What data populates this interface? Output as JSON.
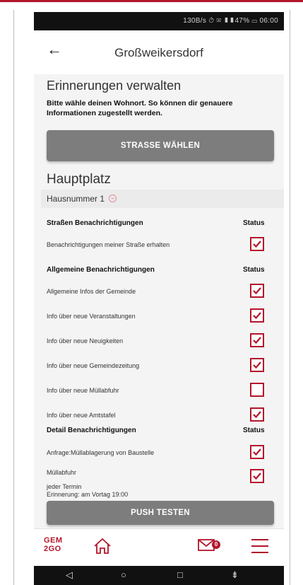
{
  "statusbar": {
    "text": "130B/s ⏱ ✉ ▮▮47% ▭ 06:00"
  },
  "header": {
    "back_icon": "arrow-left-icon",
    "title": "Großweikersdorf"
  },
  "main": {
    "heading": "Erinnerungen verwalten",
    "intro": "Bitte wähle deinen Wohnort. So können dir genauere Informationen zugestellt werden.",
    "select_street_button": "STRASSE WÄHLEN",
    "street_name": "Hauptplatz",
    "house_number_label": "Hausnummer 1",
    "remove_icon": "minus-circle-icon",
    "status_header": "Status",
    "sections": [
      {
        "title": "Straßen Benachrichtigungen",
        "items": [
          {
            "label": "Benachrichtigungen meiner Straße erhalten",
            "checked": true
          }
        ]
      },
      {
        "title": "Allgemeine Benachrichtigungen",
        "items": [
          {
            "label": "Allgemeine Infos der Gemeinde",
            "checked": true
          },
          {
            "label": "Info über neue Veranstaltungen",
            "checked": true
          },
          {
            "label": "Info über neue Neuigkeiten",
            "checked": true
          },
          {
            "label": "Info über neue Gemeindezeitung",
            "checked": true
          },
          {
            "label": "Info über neue Müllabfuhr",
            "checked": false
          },
          {
            "label": "Info über neue Amtstafel",
            "checked": true
          }
        ]
      },
      {
        "title": "Detail Benachrichtigungen",
        "items": [
          {
            "label": "Anfrage:Müllablagerung von Baustelle",
            "checked": true
          },
          {
            "label": "Müllabfuhr",
            "sub1": "jeder Termin",
            "sub2": "Erinnerung: am Vortag 19:00",
            "checked": true
          }
        ]
      }
    ],
    "push_test_button": "PUSH TESTEN"
  },
  "bottom_nav": {
    "logo_line1": "GEM",
    "logo_line2": "2GO",
    "home_icon": "home-icon",
    "mail_icon": "mail-icon",
    "mail_badge": "0",
    "menu_icon": "hamburger-menu-icon"
  },
  "system_nav": {
    "back": "◁",
    "home": "○",
    "recents": "□",
    "extra": "⇟"
  },
  "colors": {
    "accent": "#b2162a",
    "button": "#7d7d7d",
    "background": "#f4f4f4"
  }
}
